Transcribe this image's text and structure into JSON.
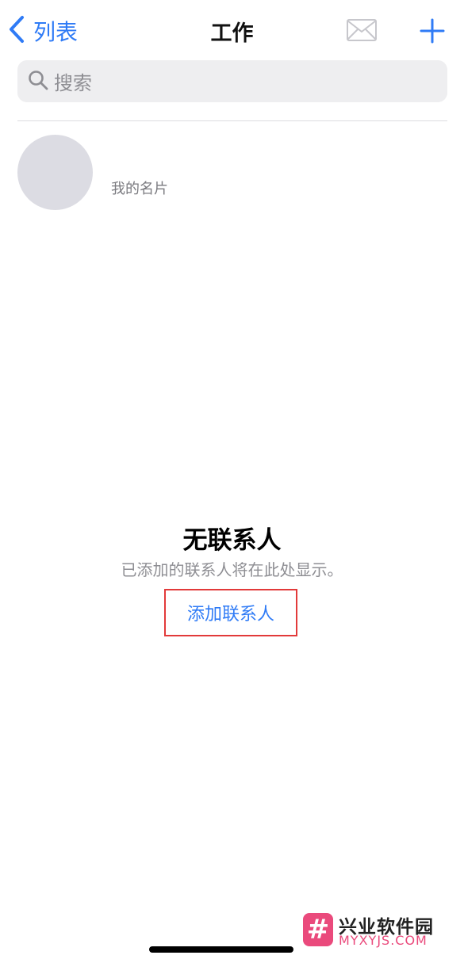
{
  "nav": {
    "back_label": "列表",
    "title": "工作",
    "icons": {
      "back": "chevron-left-icon",
      "mail": "envelope-icon",
      "add": "plus-icon"
    }
  },
  "search": {
    "placeholder": "搜索",
    "icon": "search-icon"
  },
  "my_card": {
    "label": "我的名片"
  },
  "empty_state": {
    "title": "无联系人",
    "subtitle": "已添加的联系人将在此处显示。",
    "action_label": "添加联系人"
  },
  "watermark": {
    "logo_glyph": "#",
    "name": "兴业软件园",
    "url": "MYXYJS.COM"
  },
  "colors": {
    "accent": "#2f7bf6",
    "highlight_border": "#e23a3a",
    "watermark": "#ea4a7c"
  }
}
